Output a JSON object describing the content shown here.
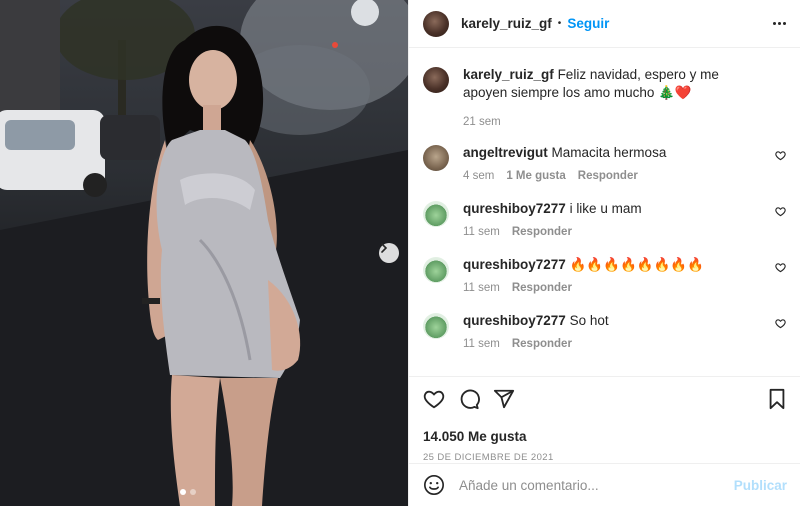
{
  "post": {
    "username": "karely_ruiz_gf",
    "follow_label": "Seguir",
    "caption": "Feliz navidad, espero y me apoyen siempre los amo mucho 🎄❤️",
    "caption_age": "21 sem",
    "likes": "14.050 Me gusta",
    "date": "25 DE DICIEMBRE DE 2021",
    "carousel_current": 1,
    "carousel_total": 2
  },
  "comments": [
    {
      "username": "angeltrevigut",
      "text": "Mamacita hermosa",
      "age": "4 sem",
      "likes": "1 Me gusta",
      "reply": "Responder"
    },
    {
      "username": "qureshiboy7277",
      "text": "i like u mam",
      "age": "11 sem",
      "reply": "Responder"
    },
    {
      "username": "qureshiboy7277",
      "text": "🔥🔥🔥🔥🔥🔥🔥🔥",
      "age": "11 sem",
      "reply": "Responder"
    },
    {
      "username": "qureshiboy7277",
      "text": "So hot",
      "age": "11 sem",
      "reply": "Responder"
    }
  ],
  "add_comment": {
    "placeholder": "Añade un comentario...",
    "publish_label": "Publicar"
  },
  "icons": {
    "more": "more-options-icon",
    "like": "heart-icon",
    "comment": "comment-icon",
    "share": "share-icon",
    "save": "bookmark-icon",
    "emoji": "emoji-icon",
    "next": "chevron-right-icon"
  },
  "colors": {
    "accent": "#0095f6",
    "publish_disabled": "#b2dffc",
    "muted": "#8e8e8e",
    "text": "#262626"
  }
}
